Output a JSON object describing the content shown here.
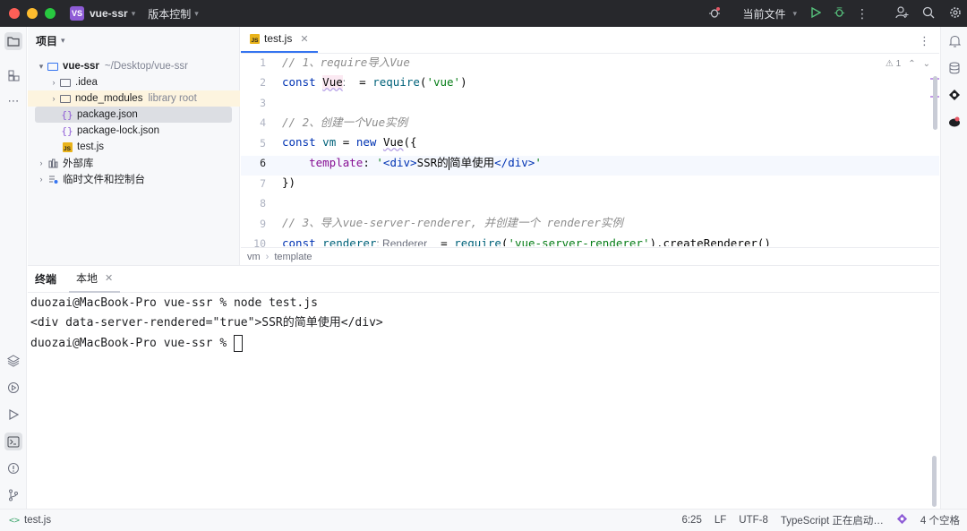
{
  "titlebar": {
    "project_badge": "VS",
    "project_name": "vue-ssr",
    "vcs_label": "版本控制",
    "run_config": "当前文件",
    "icons": [
      "bug-icon",
      "run-icon",
      "debug-icon",
      "more-icon",
      "add-user-icon",
      "search-icon",
      "gear-icon"
    ]
  },
  "project_panel": {
    "title": "项目",
    "tree": [
      {
        "label": "vue-ssr",
        "extra": "~/Desktop/vue-ssr"
      },
      {
        "label": ".idea"
      },
      {
        "label": "node_modules",
        "extra": "library root"
      },
      {
        "label": "package.json"
      },
      {
        "label": "package-lock.json"
      },
      {
        "label": "test.js"
      },
      {
        "label": "外部库"
      },
      {
        "label": "临时文件和控制台"
      }
    ]
  },
  "editor": {
    "tab_label": "test.js",
    "file_badge": "JS",
    "warning_count": "1",
    "line_numbers": [
      "1",
      "2",
      "3",
      "4",
      "5",
      "6",
      "7",
      "8",
      "9",
      "10"
    ],
    "lines": {
      "l1": "// 1、require导入Vue",
      "l2_kw": "const",
      "l2_var": "Vue",
      "l2_hint": ":",
      "l2_eq": "=",
      "l2_fn": "require",
      "l2_str": "'vue'",
      "l4": "// 2、创建一个Vue实例",
      "l5_kw": "const",
      "l5_var": "vm",
      "l5_eq": "=",
      "l5_new": "new",
      "l5_cls": "Vue",
      "l5_end": "({",
      "l6_prop": "template",
      "l6_colon": ":",
      "l6_q1": "'",
      "l6_open": "<div>",
      "l6_text_a": "SSR的",
      "l6_text_b": "简单使用",
      "l6_close": "</div>",
      "l6_q2": "'",
      "l7": "})",
      "l9_a": "// 3、导入vue-server-renderer, 并创建一个 renderer实例",
      "l10_kw": "const",
      "l10_var": "renderer",
      "l10_hint": ": Renderer",
      "l10_eq": "=",
      "l10_fn": "require",
      "l10_str": "'vue-server-renderer'",
      "l10_tail": ").createRenderer()"
    },
    "breadcrumb": [
      "vm",
      "template"
    ]
  },
  "terminal": {
    "title": "终端",
    "tab_label": "本地",
    "lines": [
      "duozai@MacBook-Pro vue-ssr % node test.js",
      "<div data-server-rendered=\"true\">SSR的简单使用</div>",
      "duozai@MacBook-Pro vue-ssr % "
    ]
  },
  "statusbar": {
    "file": "test.js",
    "position": "6:25",
    "line_sep": "LF",
    "encoding": "UTF-8",
    "language": "TypeScript 正在启动…",
    "indent": "4 个空格"
  }
}
